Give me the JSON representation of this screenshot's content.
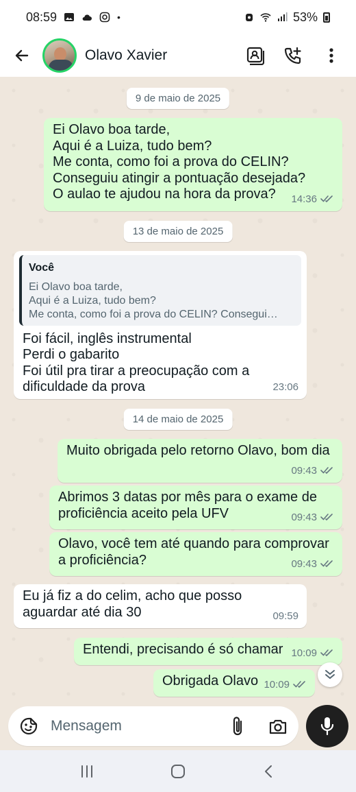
{
  "status_bar": {
    "time": "08:59",
    "battery": "53%"
  },
  "header": {
    "contact_name": "Olavo Xavier"
  },
  "dates": [
    "9 de maio de 2025",
    "13 de maio de 2025",
    "14 de maio de 2025"
  ],
  "messages": [
    {
      "text": "Ei Olavo boa tarde,\nAqui é a Luiza, tudo bem?\nMe conta, como foi a prova do CELIN?\nConseguiu atingir a pontuação desejada?\nO aulao te ajudou na hora da prova?",
      "time": "14:36"
    },
    {
      "quote_author": "Você",
      "quote_text": "Ei Olavo boa tarde,\nAqui é a Luiza, tudo bem?\nMe conta, como foi a prova do CELIN? Consegui…",
      "text": "Foi fácil, inglês instrumental\nPerdi o gabarito\nFoi útil pra tirar a preocupação com a\ndificuldade da prova",
      "time": "23:06"
    },
    {
      "text": "Muito obrigada pelo retorno Olavo, bom dia",
      "time": "09:43"
    },
    {
      "text": "Abrimos 3 datas por mês para o exame de\nproficiência aceito pela UFV",
      "time": "09:43"
    },
    {
      "text": "Olavo, você tem até quando para comprovar\na proficiência?",
      "time": "09:43"
    },
    {
      "text": "Eu já fiz a do celim, acho que posso\naguardar até dia 30",
      "time": "09:59"
    },
    {
      "text": "Entendi, precisando é só chamar",
      "time": "10:09"
    },
    {
      "text": "Obrigada Olavo",
      "time": "10:09"
    }
  ],
  "composer": {
    "placeholder": "Mensagem"
  },
  "colors": {
    "outgoing": "#d9fdd3",
    "incoming": "#ffffff",
    "read_ticks": "#667781",
    "avatar_ring": "#25d366"
  },
  "icons": [
    "back-arrow-icon",
    "video-call-icon",
    "add-call-icon",
    "more-vert-icon",
    "sticker-icon",
    "attach-icon",
    "camera-icon",
    "mic-icon",
    "scroll-down-icon"
  ]
}
